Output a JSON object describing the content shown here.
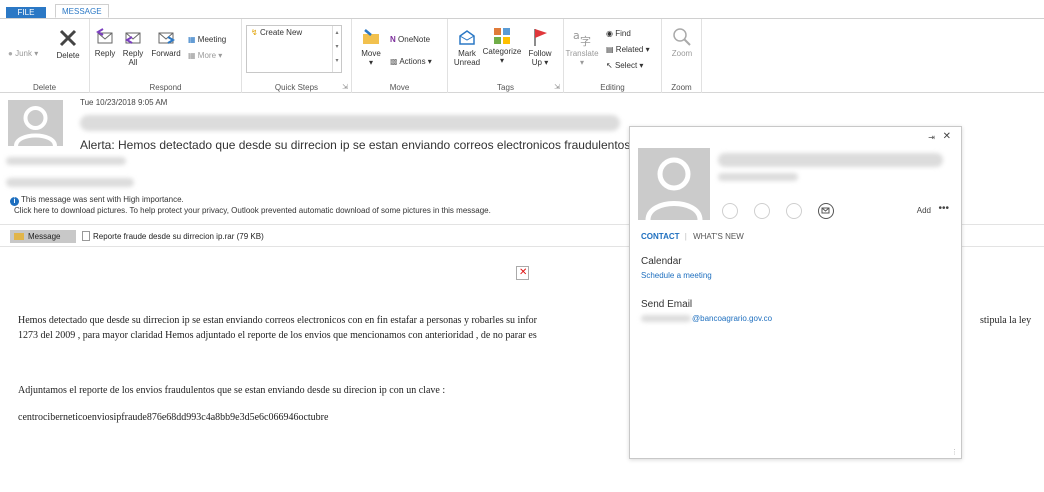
{
  "tabs": {
    "file": "FILE",
    "message": "MESSAGE"
  },
  "ribbon": {
    "delete_group": {
      "label": "Delete",
      "junk": "Junk",
      "delete": "Delete"
    },
    "respond_group": {
      "label": "Respond",
      "reply": "Reply",
      "reply_all_1": "Reply",
      "reply_all_2": "All",
      "forward": "Forward",
      "meeting": "Meeting",
      "more": "More"
    },
    "quick_steps": {
      "label": "Quick Steps",
      "create_new": "Create New"
    },
    "move_group": {
      "label": "Move",
      "move": "Move",
      "onenote": "OneNote",
      "actions": "Actions"
    },
    "tags_group": {
      "label": "Tags",
      "mark_1": "Mark",
      "mark_2": "Unread",
      "categorize": "Categorize",
      "follow_1": "Follow",
      "follow_2": "Up"
    },
    "editing_group": {
      "label": "Editing",
      "translate": "Translate",
      "find": "Find",
      "related": "Related",
      "select": "Select"
    },
    "zoom_group": {
      "label": "Zoom",
      "zoom": "Zoom"
    }
  },
  "message": {
    "date": "Tue 10/23/2018 9:05 AM",
    "subject": "Alerta:  Hemos detectado que desde su dirrecion ip se estan enviando correos electronicos fraudulentos",
    "importance_line1": "This message was sent with High importance.",
    "importance_line2": "Click here to download pictures. To help protect your privacy, Outlook prevented automatic download of some pictures in this message.",
    "message_tab": "Message",
    "attachment": "Reporte fraude desde su dirrecion ip.rar (79 KB)",
    "body": {
      "p1_line1": "Hemos detectado que desde su dirrecion ip se estan enviando correos electronicos con en fin estafar a personas y robarles su infor",
      "p1_line1_end": "stipula la ley",
      "p1_line2": "1273 del 2009 ,  para mayor claridad Hemos adjuntado el reporte de los envios que mencionamos con anterioridad , de no parar es",
      "p2": "Adjuntamos el reporte de los envios fraudulentos que se estan enviando desde su direcion ip con un clave :",
      "p3": "centrociberneticoenviosipfraude876e68dd993c4a8bb9e3d5e6c066946octubre"
    }
  },
  "contact_card": {
    "add": "Add",
    "more": "•••",
    "tab_contact": "CONTACT",
    "tab_whats_new": "WHAT'S NEW",
    "calendar_header": "Calendar",
    "schedule_link": "Schedule a meeting",
    "send_email_header": "Send Email",
    "email_domain": "@bancoagrario.gov.co"
  },
  "colors": {
    "accent": "#2b78c5",
    "link": "#1e6fbf"
  }
}
